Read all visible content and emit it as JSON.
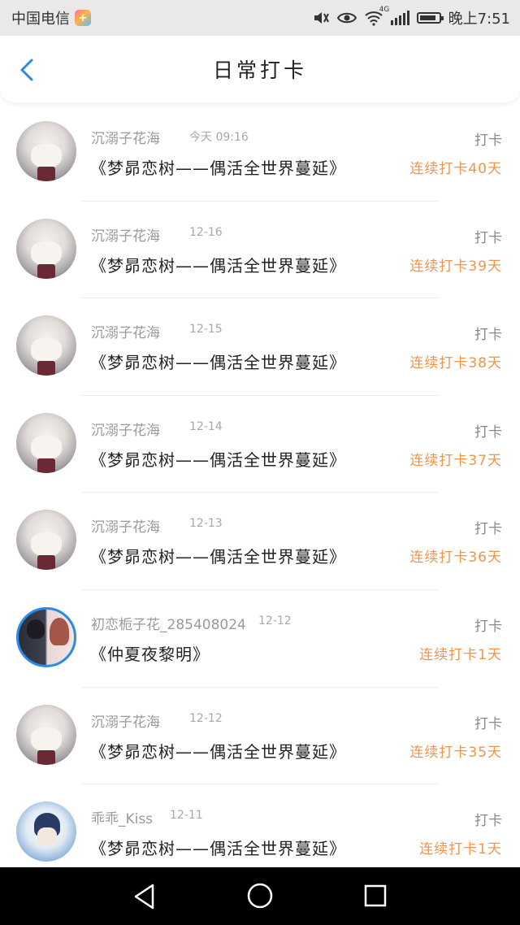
{
  "status_bar": {
    "carrier": "中国电信",
    "network": "4G",
    "time": "晚上7:51",
    "battery_level": 0.9
  },
  "header": {
    "title": "日常打卡",
    "back_icon": "chevron-left-icon"
  },
  "checkins": [
    {
      "user": "沉溺子花海",
      "time": "今天 09:16",
      "book": "《梦昴恋树——偶活全世界蔓延》",
      "tag": "打卡",
      "streak": "连续打卡40天",
      "avatar": "anime"
    },
    {
      "user": "沉溺子花海",
      "time": "12-16",
      "book": "《梦昴恋树——偶活全世界蔓延》",
      "tag": "打卡",
      "streak": "连续打卡39天",
      "avatar": "anime"
    },
    {
      "user": "沉溺子花海",
      "time": "12-15",
      "book": "《梦昴恋树——偶活全世界蔓延》",
      "tag": "打卡",
      "streak": "连续打卡38天",
      "avatar": "anime"
    },
    {
      "user": "沉溺子花海",
      "time": "12-14",
      "book": "《梦昴恋树——偶活全世界蔓延》",
      "tag": "打卡",
      "streak": "连续打卡37天",
      "avatar": "anime"
    },
    {
      "user": "沉溺子花海",
      "time": "12-13",
      "book": "《梦昴恋树——偶活全世界蔓延》",
      "tag": "打卡",
      "streak": "连续打卡36天",
      "avatar": "anime"
    },
    {
      "user": "初恋栀子花_285408024",
      "time": "12-12",
      "book": "《仲夏夜黎明》",
      "tag": "打卡",
      "streak": "连续打卡1天",
      "avatar": "couple"
    },
    {
      "user": "沉溺子花海",
      "time": "12-12",
      "book": "《梦昴恋树——偶活全世界蔓延》",
      "tag": "打卡",
      "streak": "连续打卡35天",
      "avatar": "anime"
    },
    {
      "user": "乖乖_Kiss",
      "time": "12-11",
      "book": "《梦昴恋树——偶活全世界蔓延》",
      "tag": "打卡",
      "streak": "连续打卡1天",
      "avatar": "kiss"
    }
  ],
  "colors": {
    "accent_orange": "#f0944a",
    "back_blue": "#2a8ae6"
  },
  "system_nav": {
    "back": "triangle-back-icon",
    "home": "circle-home-icon",
    "recents": "square-recents-icon"
  }
}
